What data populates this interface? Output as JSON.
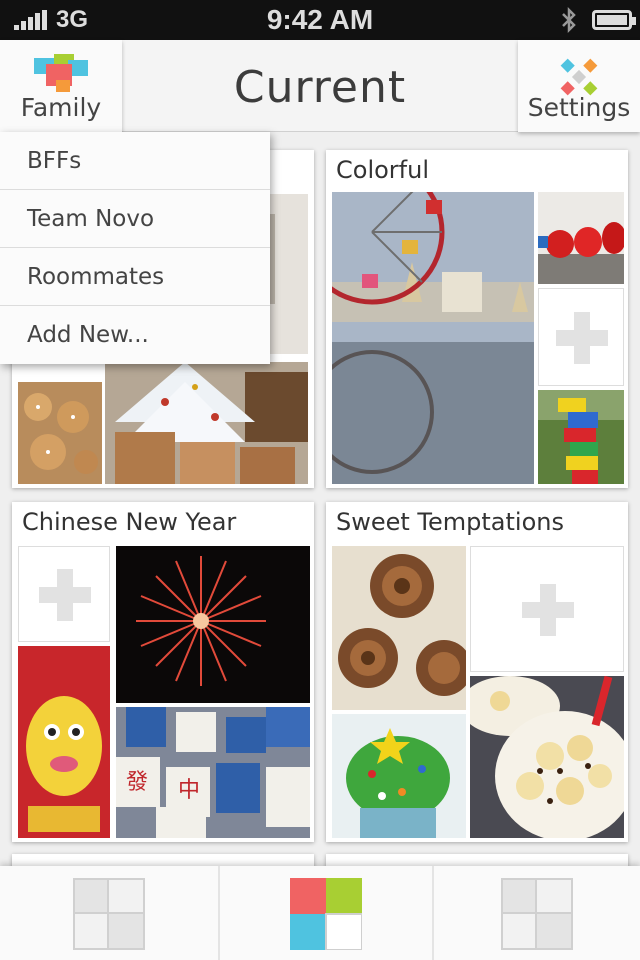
{
  "status_bar": {
    "carrier": "3G",
    "time": "9:42 AM"
  },
  "header": {
    "title": "Current",
    "left_button": {
      "label": "Family",
      "icon": "family-logo-icon"
    },
    "right_button": {
      "label": "Settings",
      "icon": "settings-logo-icon"
    }
  },
  "dropdown": {
    "items": [
      "BFFs",
      "Team Novo",
      "Roommates",
      "Add New..."
    ]
  },
  "albums": [
    {
      "title": "",
      "tiles": [
        "gingerbread-cookies-photo",
        "christmas-tree-gifts-photo",
        "room-interior-photo"
      ]
    },
    {
      "title": "Colorful",
      "tiles": [
        "ferris-wheel-lake-photo",
        "red-ducks-photo",
        "add-photo",
        "lego-tower-photo"
      ]
    },
    {
      "title": "Chinese New Year",
      "tiles": [
        "add-photo",
        "fireworks-photo",
        "golden-dragon-poster-photo",
        "mahjong-tiles-photo"
      ]
    },
    {
      "title": "Sweet Temptations",
      "tiles": [
        "cinnamon-rolls-photo",
        "add-photo",
        "green-cupcake-photo",
        "banana-chocolate-bowl-photo"
      ]
    }
  ],
  "tabbar": {
    "tabs": [
      {
        "name": "grid-left",
        "active": false
      },
      {
        "name": "grid-center",
        "active": true
      },
      {
        "name": "grid-right",
        "active": false
      }
    ]
  },
  "colors": {
    "brand_red": "#f06363",
    "brand_green": "#a8cf33",
    "brand_blue": "#4fc3e0",
    "brand_orange": "#f59a3a",
    "inactive_grey": "#d8d8d8"
  }
}
